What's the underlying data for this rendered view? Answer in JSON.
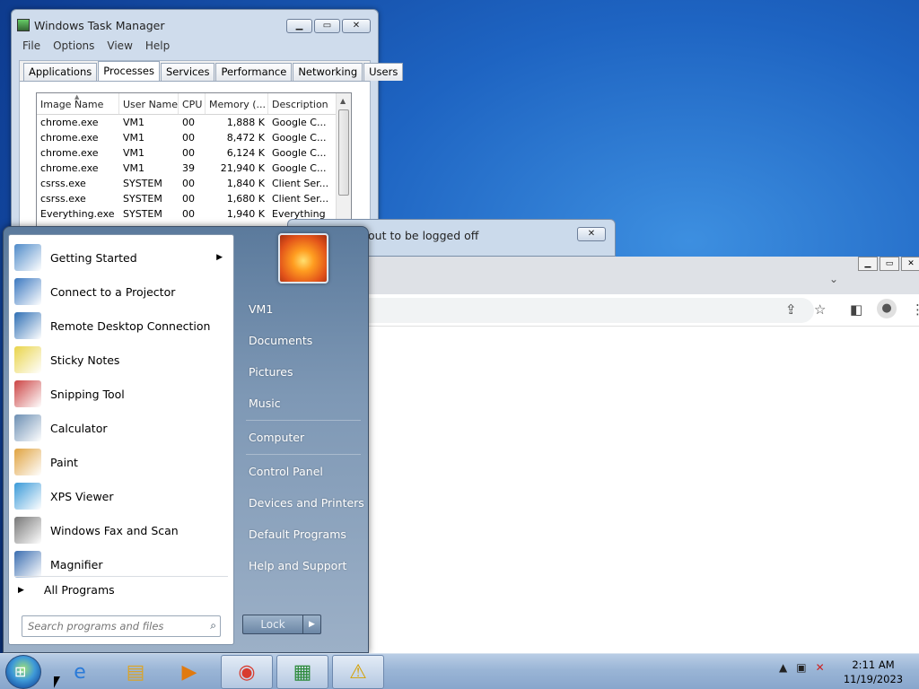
{
  "taskmgr": {
    "title": "Windows Task Manager",
    "menu": [
      "File",
      "Options",
      "View",
      "Help"
    ],
    "tabs": [
      "Applications",
      "Processes",
      "Services",
      "Performance",
      "Networking",
      "Users"
    ],
    "active_tab": "Processes",
    "columns": [
      "Image Name",
      "User Name",
      "CPU",
      "Memory (...",
      "Description"
    ],
    "rows": [
      [
        "chrome.exe",
        "VM1",
        "00",
        "1,888 K",
        "Google C..."
      ],
      [
        "chrome.exe",
        "VM1",
        "00",
        "8,472 K",
        "Google C..."
      ],
      [
        "chrome.exe",
        "VM1",
        "00",
        "6,124 K",
        "Google C..."
      ],
      [
        "chrome.exe",
        "VM1",
        "39",
        "21,940 K",
        "Google C..."
      ],
      [
        "csrss.exe",
        "SYSTEM",
        "00",
        "1,840 K",
        "Client Ser..."
      ],
      [
        "csrss.exe",
        "SYSTEM",
        "00",
        "1,680 K",
        "Client Ser..."
      ],
      [
        "Everything.exe",
        "SYSTEM",
        "00",
        "1,940 K",
        "Everything"
      ]
    ]
  },
  "logoff_dialog": {
    "title_fragment": "out to be logged off"
  },
  "start_menu": {
    "left_items": [
      {
        "label": "Getting Started",
        "icon": "getting-started-icon",
        "submenu": true
      },
      {
        "label": "Connect to a Projector",
        "icon": "projector-icon"
      },
      {
        "label": "Remote Desktop Connection",
        "icon": "remote-desktop-icon"
      },
      {
        "label": "Sticky Notes",
        "icon": "sticky-notes-icon"
      },
      {
        "label": "Snipping Tool",
        "icon": "snipping-tool-icon"
      },
      {
        "label": "Calculator",
        "icon": "calculator-icon"
      },
      {
        "label": "Paint",
        "icon": "paint-icon"
      },
      {
        "label": "XPS Viewer",
        "icon": "xps-viewer-icon"
      },
      {
        "label": "Windows Fax and Scan",
        "icon": "fax-scan-icon"
      },
      {
        "label": "Magnifier",
        "icon": "magnifier-icon"
      }
    ],
    "all_programs": "All Programs",
    "search_placeholder": "Search programs and files",
    "right_items": [
      "VM1",
      "Documents",
      "Pictures",
      "Music",
      "Computer",
      "Control Panel",
      "Devices and Printers",
      "Default Programs",
      "Help and Support"
    ],
    "shutdown_label": "Lock"
  },
  "taskbar": {
    "clock_time": "2:11 AM",
    "clock_date": "11/19/2023",
    "pinned": [
      "internet-explorer-icon",
      "explorer-icon",
      "media-player-icon",
      "chrome-icon",
      "task-manager-icon",
      "warning-icon"
    ]
  }
}
